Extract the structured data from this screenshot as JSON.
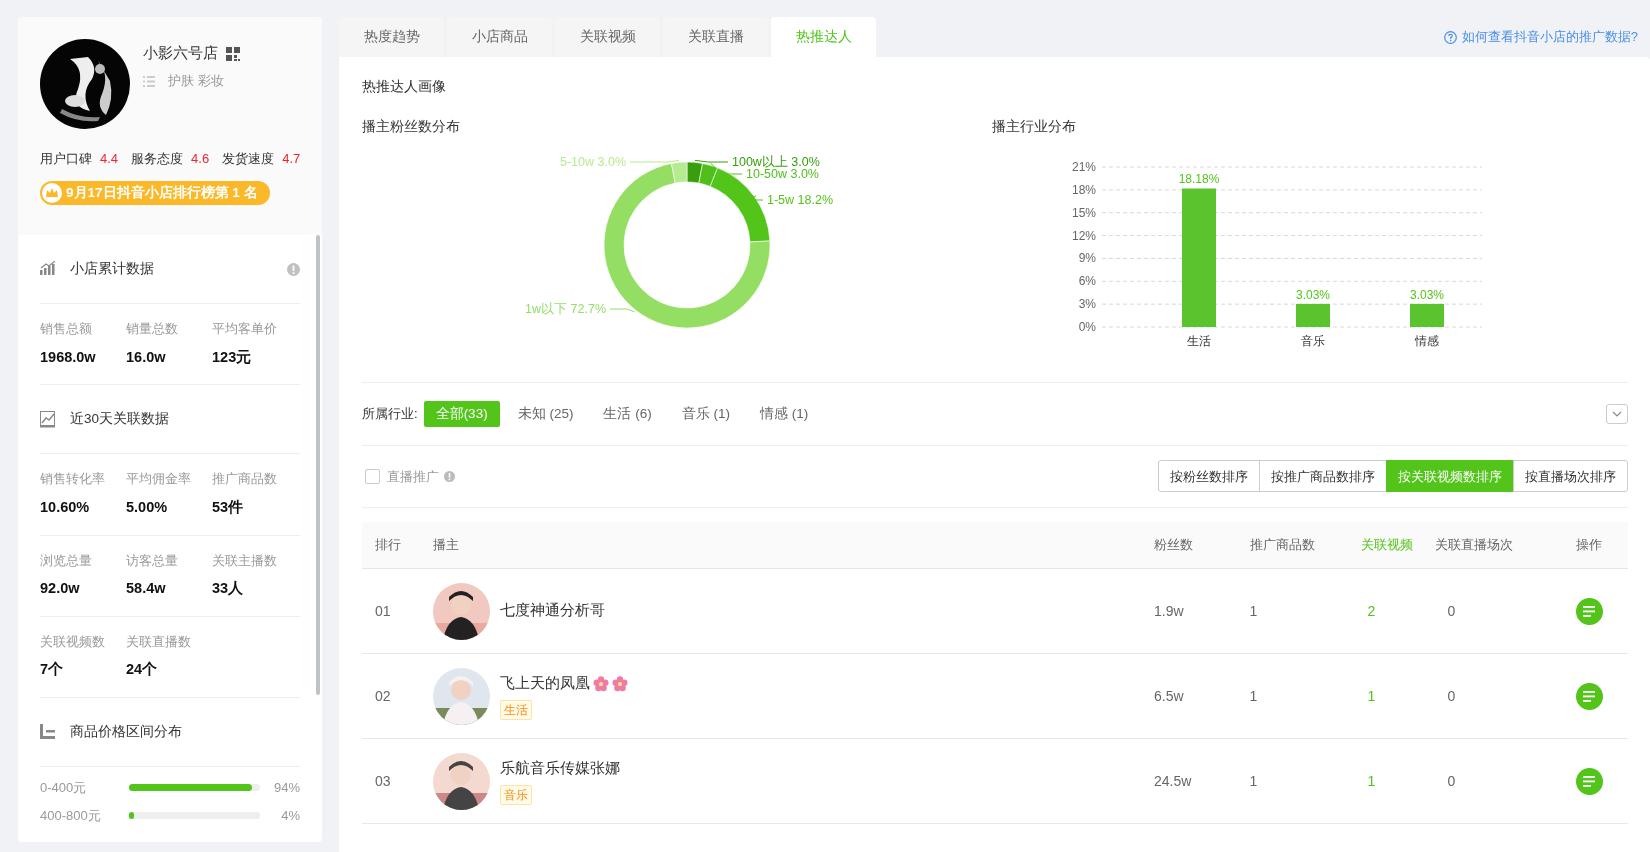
{
  "shop": {
    "name": "小影六号店",
    "categories": "护肤 彩妆",
    "ratings": [
      {
        "label": "用户口碑",
        "value": "4.4"
      },
      {
        "label": "服务态度",
        "value": "4.6"
      },
      {
        "label": "发货速度",
        "value": "4.7"
      }
    ],
    "rank_badge": "9月17日抖音小店排行榜第 1 名"
  },
  "sidebar_sections": [
    {
      "kind": "stats",
      "title": "小店累计数据",
      "info": true,
      "rows": [
        [
          {
            "label": "销售总额",
            "value": "1968.0w"
          },
          {
            "label": "销量总数",
            "value": "16.0w"
          },
          {
            "label": "平均客单价",
            "value": "123元"
          }
        ]
      ]
    },
    {
      "kind": "stats",
      "title": "近30天关联数据",
      "info": false,
      "rows": [
        [
          {
            "label": "销售转化率",
            "value": "10.60%"
          },
          {
            "label": "平均佣金率",
            "value": "5.00%"
          },
          {
            "label": "推广商品数",
            "value": "53件"
          }
        ],
        [
          {
            "label": "浏览总量",
            "value": "92.0w"
          },
          {
            "label": "访客总量",
            "value": "58.4w"
          },
          {
            "label": "关联主播数",
            "value": "33人"
          }
        ],
        [
          {
            "label": "关联视频数",
            "value": "7个"
          },
          {
            "label": "关联直播数",
            "value": "24个"
          }
        ]
      ]
    },
    {
      "kind": "bars",
      "title": "商品价格区间分布",
      "info": false,
      "bars": [
        {
          "label": "0-400元",
          "level": 0.94,
          "reading": "94%"
        },
        {
          "label": "400-800元",
          "level": 0.04,
          "reading": "4%"
        }
      ]
    }
  ],
  "tabs": [
    {
      "label": "热度趋势",
      "selected": false
    },
    {
      "label": "小店商品",
      "selected": false
    },
    {
      "label": "关联视频",
      "selected": false
    },
    {
      "label": "关联直播",
      "selected": false
    },
    {
      "label": "热推达人",
      "selected": true
    }
  ],
  "help_link": "如何查看抖音小店的推广数据?",
  "portrait_title": "热推达人画像",
  "fans_chart": {
    "title": "播主粉丝数分布",
    "chart_data": {
      "type": "donut",
      "categories": [
        "100w以上",
        "10-50w",
        "1-5w",
        "1w以下",
        "5-10w"
      ],
      "values": [
        3.0,
        3.0,
        18.2,
        72.7,
        3.0
      ],
      "data_labels": true,
      "value_labels": [
        "3.0%",
        "3.0%",
        "18.2%",
        "72.7%",
        "3.0%"
      ]
    }
  },
  "industry_chart": {
    "title": "播主行业分布",
    "chart_data": {
      "type": "bar",
      "grid": true,
      "categories": [
        "生活",
        "音乐",
        "情感"
      ],
      "values": [
        18.18,
        3.03,
        3.03
      ],
      "ylim": [
        0,
        21
      ],
      "yticks": [
        {
          "value": 0,
          "label": "0%"
        },
        {
          "value": 3,
          "label": "3%"
        },
        {
          "value": 6,
          "label": "6%"
        },
        {
          "value": 9,
          "label": "9%"
        },
        {
          "value": 12,
          "label": "12%"
        },
        {
          "value": 15,
          "label": "15%"
        },
        {
          "value": 18,
          "label": "18%"
        },
        {
          "value": 21,
          "label": "21%"
        }
      ],
      "data_labels": true,
      "value_labels": [
        "18.18%",
        "3.03%",
        "3.03%"
      ]
    }
  },
  "industry_filter": {
    "label": "所属行业:",
    "options": [
      {
        "label": "全部(33)",
        "selected": true
      },
      {
        "label": "未知 (25)",
        "selected": false
      },
      {
        "label": "生活 (6)",
        "selected": false
      },
      {
        "label": "音乐 (1)",
        "selected": false
      },
      {
        "label": "情感 (1)",
        "selected": false
      }
    ]
  },
  "live_promo": {
    "label": "直播推广",
    "checked": false
  },
  "sort_buttons": [
    {
      "label": "按粉丝数排序",
      "selected": false
    },
    {
      "label": "按推广商品数排序",
      "selected": false
    },
    {
      "label": "按关联视频数排序",
      "selected": true
    },
    {
      "label": "按直播场次排序",
      "selected": false
    }
  ],
  "table": {
    "columns": [
      {
        "label": "排行",
        "sorted": false
      },
      {
        "label": "播主",
        "sorted": false
      },
      {
        "label": "粉丝数",
        "sorted": false
      },
      {
        "label": "推广商品数",
        "sorted": false
      },
      {
        "label": "关联视频",
        "sorted": true
      },
      {
        "label": "关联直播场次",
        "sorted": false
      },
      {
        "label": "操作",
        "sorted": false
      }
    ],
    "rows": [
      {
        "rank": "01",
        "name": "七度神通分析哥",
        "decorated": false,
        "fans": "1.9w",
        "products": "1",
        "videos": "2",
        "lives": "0"
      },
      {
        "rank": "02",
        "name": "飞上天的凤凰",
        "decorated": true,
        "tag": "生活",
        "fans": "6.5w",
        "products": "1",
        "videos": "1",
        "lives": "0"
      },
      {
        "rank": "03",
        "name": "乐航音乐传媒张娜",
        "decorated": false,
        "tag": "音乐",
        "fans": "24.5w",
        "products": "1",
        "videos": "1",
        "lives": "0"
      }
    ]
  }
}
